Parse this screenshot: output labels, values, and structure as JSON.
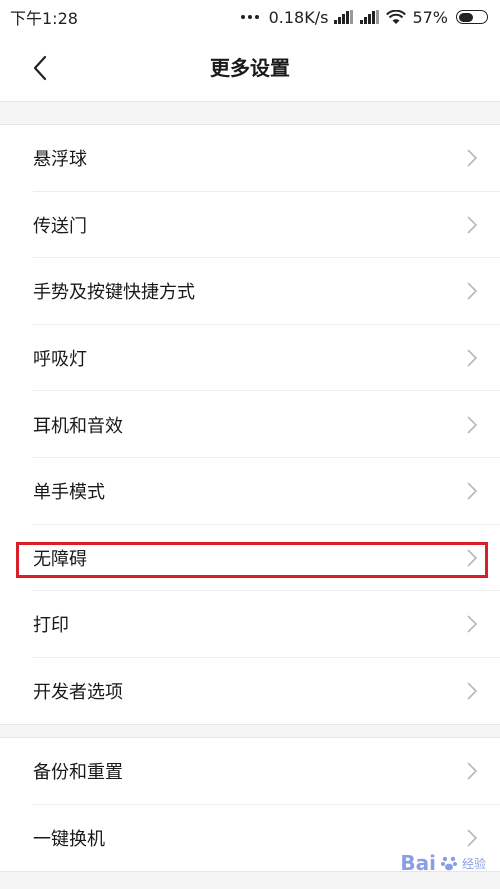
{
  "status_bar": {
    "time": "下午1:28",
    "net_speed": "0.18K/s",
    "battery": "57%",
    "battery_level": 0.57
  },
  "header": {
    "title": "更多设置"
  },
  "groups": [
    {
      "items": [
        {
          "label": "悬浮球"
        },
        {
          "label": "传送门"
        },
        {
          "label": "手势及按键快捷方式"
        },
        {
          "label": "呼吸灯"
        },
        {
          "label": "耳机和音效"
        },
        {
          "label": "单手模式"
        },
        {
          "label": "无障碍",
          "highlighted": true
        },
        {
          "label": "打印"
        },
        {
          "label": "开发者选项"
        }
      ]
    },
    {
      "items": [
        {
          "label": "备份和重置"
        },
        {
          "label": "一键换机"
        }
      ]
    }
  ],
  "watermark": {
    "brand": "Bai",
    "sub": "经验"
  },
  "colors": {
    "highlight": "#d8202a",
    "background": "#f5f5f5"
  }
}
